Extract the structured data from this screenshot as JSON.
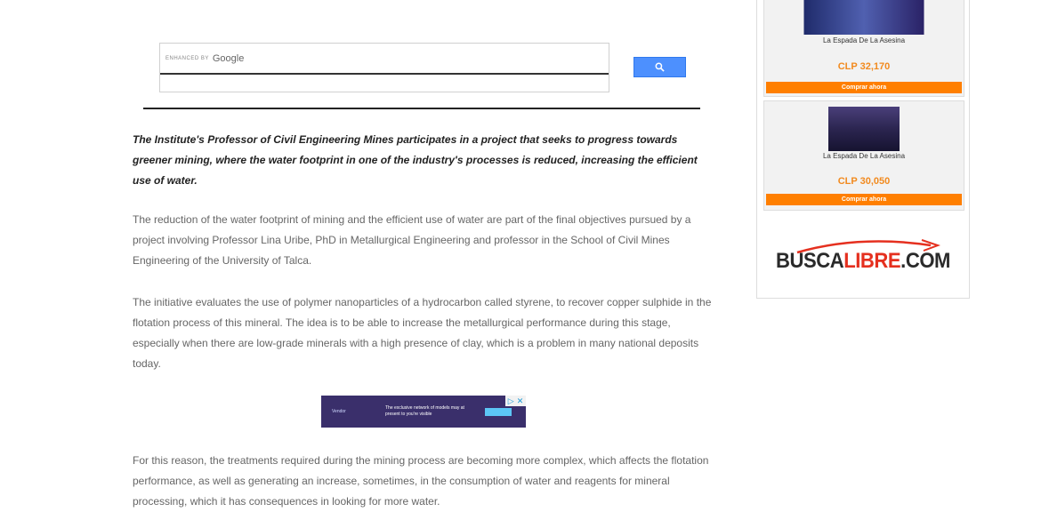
{
  "search": {
    "brand_prefix": "ENHANCED BY",
    "brand_name": "Google"
  },
  "article": {
    "lead": "The Institute's Professor of Civil Engineering Mines participates in a project that seeks to progress towards greener mining, where the water footprint in one of the industry's processes is reduced, increasing the efficient use of water.",
    "paragraphs": [
      "The reduction of the water footprint of mining and the efficient use of water are part of the final objectives pursued by a project involving Professor Lina Uribe, PhD in Metallurgical Engineering and professor in the School of Civil Mines Engineering of the University of Talca.",
      "The initiative evaluates the use of polymer nanoparticles of a hydrocarbon called styrene, to recover copper sulphide in the flotation process of this mineral. The idea is to be able to increase the metallurgical performance during this stage, especially when there are low-grade minerals with a high presence of clay, which is a problem in many national deposits today.",
      "For this reason, the treatments required during the mining process are becoming more complex, which affects the flotation performance, as well as generating an increase, sometimes, in the consumption of water and reagents for mineral processing, which it has consequences in looking for more water."
    ]
  },
  "banner_ad": {
    "brand": "Vendor",
    "text": "The exclusive network of models may at present to you're visible"
  },
  "sidebar": {
    "books": [
      {
        "title": "La Espada De La Asesina",
        "price": "CLP 32,170",
        "button": "Comprar ahora"
      },
      {
        "title": "La Espada De La Asesina",
        "price": "CLP 30,050",
        "button": "Comprar ahora"
      }
    ],
    "logo": {
      "part1": "BUSCA",
      "part2": "LIBRE",
      "part3": ".COM"
    }
  },
  "colors": {
    "search_button": "#4d90fe",
    "buy_button": "#ff7f00",
    "price": "#f28a1e",
    "logo_red": "#e5301f"
  }
}
